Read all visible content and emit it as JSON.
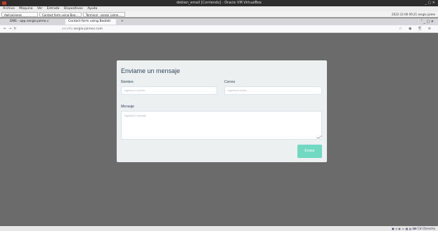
{
  "vbox": {
    "title": "debian_email [Corriendo] - Oracle VM VirtualBox",
    "controls": "_ ▢ ✕",
    "menu": [
      "Archivo",
      "Máquina",
      "Ver",
      "Entrada",
      "Dispositivos",
      "Ayuda"
    ],
    "status_right": "Ctrl Derecho"
  },
  "taskbar": {
    "apps": [
      "Aplicaciones",
      "Contact form using Boo...",
      "Terminal - sergio_jaime..."
    ],
    "tray_time": "2022-12-06 09:21",
    "tray_user": "sergio jaime"
  },
  "browser": {
    "tabs": [
      "DNS - app.sergio.jaime.c",
      "Contact form using Bootstr"
    ],
    "new_tab": "+",
    "url_prefix": "sendto.",
    "url_domain": "sergio-jaimes.com"
  },
  "form": {
    "title": "Enviame un mensaje",
    "name_label": "Nombre",
    "name_placeholder": "Ingresa el nombre",
    "email_label": "Correo",
    "email_placeholder": "Ingresa el correo",
    "message_label": "Mensaje",
    "message_placeholder": "Ingresa tu mensaje",
    "submit_label": "Enviar"
  }
}
